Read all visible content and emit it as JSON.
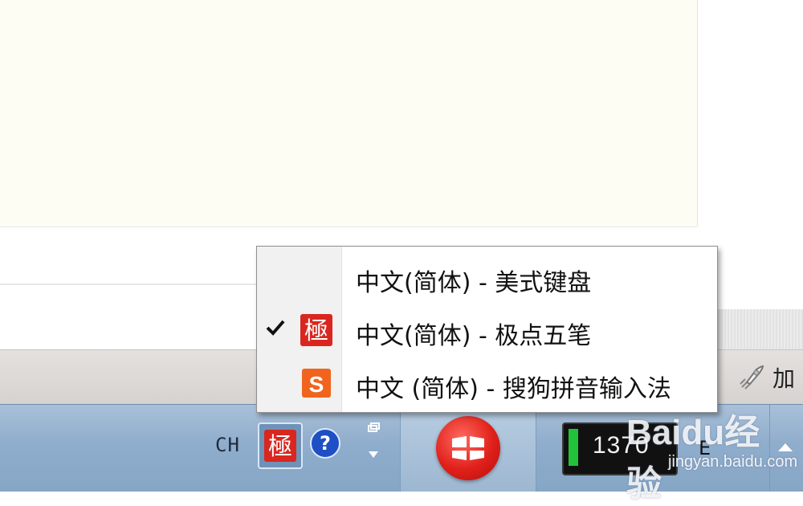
{
  "menu": {
    "items": [
      {
        "label": "中文(简体) - 美式键盘",
        "checked": false,
        "icon": "none"
      },
      {
        "label": "中文(简体) - 极点五笔",
        "checked": true,
        "icon": "jidian-ime-icon"
      },
      {
        "label": "中文 (简体) - 搜狗拼音输入法",
        "checked": false,
        "icon": "sogou-ime-icon"
      }
    ],
    "sogou_glyph": "S",
    "jidian_glyph": "極"
  },
  "status_bar": {
    "right_label": "加"
  },
  "taskbar": {
    "language_indicator": "CH",
    "ime_glyph": "極",
    "help_glyph": "?",
    "battery_text": "1370",
    "extra_tray_glyph": "E"
  },
  "watermark": {
    "brand": "Baidu经验",
    "site": "jingyan.baidu.com"
  },
  "colors": {
    "accent_red": "#e0201a",
    "sogou_orange": "#f0641e",
    "help_blue": "#1f4fc4",
    "battery_green": "#22c33a"
  }
}
